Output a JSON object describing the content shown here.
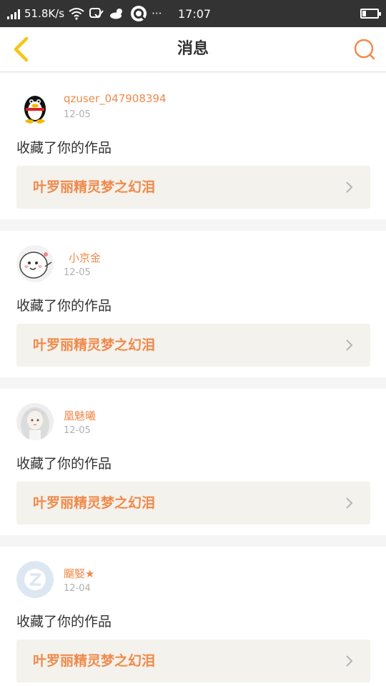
{
  "status_bar": {
    "speed": "51.8K/s",
    "time": "17:07",
    "more": "···"
  },
  "header": {
    "title": "消息"
  },
  "messages": [
    {
      "username": "qzuser_047908394",
      "date": "12-05",
      "action": "收藏了你的作品",
      "work_title": "叶罗丽精灵梦之幻泪"
    },
    {
      "username": "小京金",
      "date": "12-05",
      "action": "收藏了你的作品",
      "work_title": "叶罗丽精灵梦之幻泪"
    },
    {
      "username": "凰魅曦",
      "date": "12-05",
      "action": "收藏了你的作品",
      "work_title": "叶罗丽精灵梦之幻泪"
    },
    {
      "username": "飀婜★",
      "date": "12-04",
      "action": "收藏了你的作品",
      "work_title": "叶罗丽精灵梦之幻泪"
    }
  ],
  "colors": {
    "accent": "#f08a4b",
    "back_arrow": "#f5c518",
    "status_bar_bg": "#333333"
  }
}
